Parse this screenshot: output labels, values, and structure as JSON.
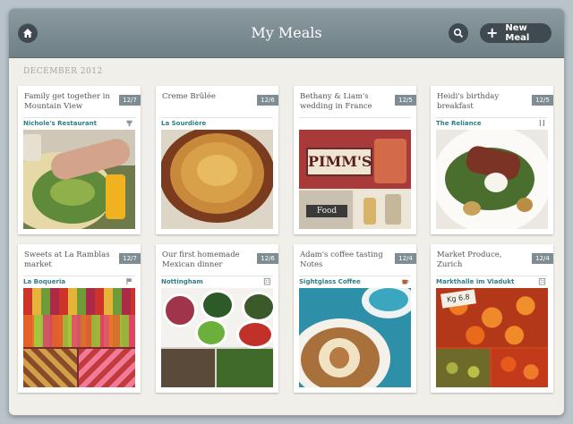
{
  "header": {
    "title": "My Meals",
    "new_button_label": "New Meal"
  },
  "section_label": "DECEMBER 2012",
  "meals": [
    {
      "title": "Family get together in Mountain View",
      "date": "12/7",
      "place": "Nichole's Restaurant",
      "place_icon": "cafe-icon"
    },
    {
      "title": "Creme Brûlée",
      "date": "12/6",
      "place": "La Sourdière",
      "place_icon": ""
    },
    {
      "title": "Bethany & Liam's wedding in France",
      "date": "12/5",
      "place": "",
      "place_icon": ""
    },
    {
      "title": "Heidi's birthday breakfast",
      "date": "12/5",
      "place": "The Reliance",
      "place_icon": "fork-knife-icon"
    },
    {
      "title": "Sweets at La Ramblas market",
      "date": "12/7",
      "place": "La Boqueria",
      "place_icon": "flag-icon"
    },
    {
      "title": "Our first homemade Mexican dinner",
      "date": "12/6",
      "place": "Nottingham",
      "place_icon": "building-icon"
    },
    {
      "title": "Adam's coffee tasting Notes",
      "date": "12/4",
      "place": "Sightglass Coffee",
      "place_icon": "coffee-cup-icon"
    },
    {
      "title": "Market Produce, Zurich",
      "date": "12/4",
      "place": "Markthalle im Viadukt",
      "place_icon": "building-icon"
    }
  ],
  "photo_signs": {
    "pimms": "PIMM'S",
    "food": "Food",
    "price": "Kg 6.8"
  }
}
